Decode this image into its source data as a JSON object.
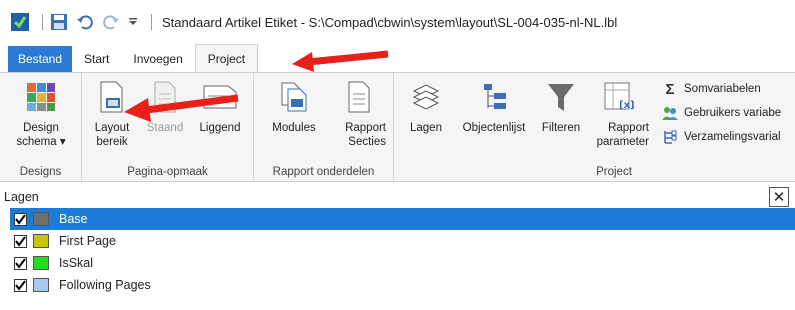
{
  "title": {
    "window_title": "Standaard Artikel Etiket - S:\\Compad\\cbwin\\system\\layout\\SL-004-035-nl-NL.lbl"
  },
  "tabs": [
    {
      "label": "Bestand"
    },
    {
      "label": "Start"
    },
    {
      "label": "Invoegen"
    },
    {
      "label": "Project"
    }
  ],
  "ribbon": {
    "groups": {
      "designs": "Designs",
      "pagina": "Pagina-opmaak",
      "rapport": "Rapport onderdelen",
      "project": "Project"
    },
    "buttons": {
      "design_schema": "Design schema ▾",
      "layout_bereik": "Layout bereik",
      "staand": "Staand",
      "liggend": "Liggend",
      "modules": "Modules",
      "rapport_secties": "Rapport Secties",
      "lagen": "Lagen",
      "objectenlijst": "Objectenlijst",
      "filteren": "Filteren",
      "rapport_parameter": "Rapport parameter",
      "somvariabelen": "Somvariabelen",
      "gebruikers": "Gebruikers variabe",
      "verzamelingsvar": "Verzamelingsvarial"
    }
  },
  "panel": {
    "title": "Lagen",
    "close": "✕"
  },
  "layers": [
    {
      "name": "Base",
      "color": "#6e6e6e",
      "checked": true,
      "selected": true
    },
    {
      "name": "First Page",
      "color": "#c9c400",
      "checked": true,
      "selected": false
    },
    {
      "name": "IsSkal",
      "color": "#22dd22",
      "checked": true,
      "selected": false
    },
    {
      "name": "Following Pages",
      "color": "#a9c9ee",
      "checked": true,
      "selected": false
    }
  ],
  "colors": {
    "accent": "#2b7bd4",
    "selection": "#1c7bd6",
    "annotation_arrow": "#e8201a"
  }
}
